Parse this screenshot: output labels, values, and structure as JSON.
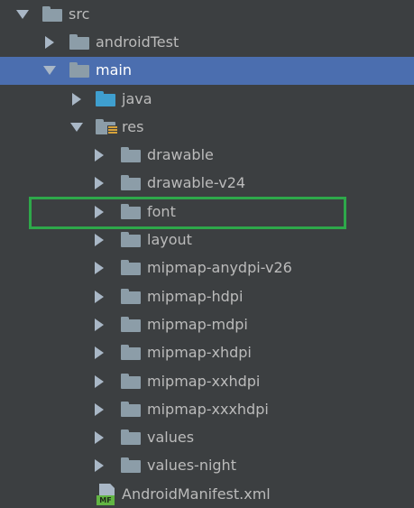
{
  "tree": {
    "items": [
      {
        "label": "src",
        "icon": "folder-icon"
      },
      {
        "label": "androidTest",
        "icon": "folder-icon"
      },
      {
        "label": "main",
        "icon": "folder-icon"
      },
      {
        "label": "java",
        "icon": "source-folder-icon"
      },
      {
        "label": "res",
        "icon": "resources-folder-icon"
      },
      {
        "label": "drawable",
        "icon": "folder-icon"
      },
      {
        "label": "drawable-v24",
        "icon": "folder-icon"
      },
      {
        "label": "font",
        "icon": "folder-icon"
      },
      {
        "label": "layout",
        "icon": "folder-icon"
      },
      {
        "label": "mipmap-anydpi-v26",
        "icon": "folder-icon"
      },
      {
        "label": "mipmap-hdpi",
        "icon": "folder-icon"
      },
      {
        "label": "mipmap-mdpi",
        "icon": "folder-icon"
      },
      {
        "label": "mipmap-xhdpi",
        "icon": "folder-icon"
      },
      {
        "label": "mipmap-xxhdpi",
        "icon": "folder-icon"
      },
      {
        "label": "mipmap-xxxhdpi",
        "icon": "folder-icon"
      },
      {
        "label": "values",
        "icon": "folder-icon"
      },
      {
        "label": "values-night",
        "icon": "folder-icon"
      },
      {
        "label": "AndroidManifest.xml",
        "icon": "manifest-file-icon",
        "badge": "MF"
      }
    ],
    "selected_label": "main",
    "highlighted_label": "font"
  },
  "colors": {
    "background": "#3c3f41",
    "selection": "#4b6eaf",
    "highlight_border": "#2ea84a",
    "folder": "#8c9da8",
    "source_folder": "#3f9fcf"
  }
}
